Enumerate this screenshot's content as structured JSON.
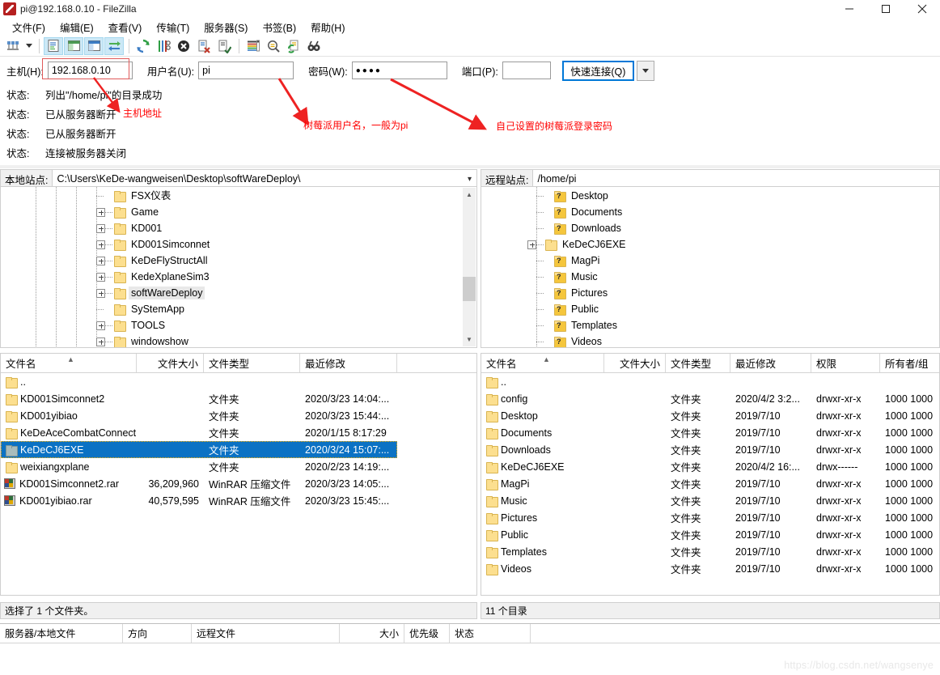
{
  "window": {
    "title": "pi@192.168.0.10 - FileZilla",
    "icon": "filezilla-icon",
    "minimize": "minimize-icon",
    "maximize": "maximize-icon",
    "close": "close-icon"
  },
  "menubar": {
    "items": [
      {
        "label": "文件(F)",
        "name": "menu-file"
      },
      {
        "label": "编辑(E)",
        "name": "menu-edit"
      },
      {
        "label": "查看(V)",
        "name": "menu-view"
      },
      {
        "label": "传输(T)",
        "name": "menu-transfer"
      },
      {
        "label": "服务器(S)",
        "name": "menu-server"
      },
      {
        "label": "书签(B)",
        "name": "menu-bookmarks"
      },
      {
        "label": "帮助(H)",
        "name": "menu-help"
      }
    ]
  },
  "toolbar": {
    "buttons": [
      {
        "name": "site-manager-icon",
        "pressed": false
      },
      {
        "name": "dropdown-caret-icon",
        "pressed": false
      },
      {
        "name": "toggle-message-log-icon",
        "pressed": true
      },
      {
        "name": "toggle-local-tree-icon",
        "pressed": true
      },
      {
        "name": "toggle-remote-tree-icon",
        "pressed": true
      },
      {
        "name": "toggle-transfer-queue-icon",
        "pressed": true
      },
      {
        "name": "refresh-icon",
        "pressed": false
      },
      {
        "name": "process-queue-icon",
        "pressed": false
      },
      {
        "name": "cancel-operation-icon",
        "pressed": false
      },
      {
        "name": "disconnect-icon",
        "pressed": false
      },
      {
        "name": "reconnect-icon",
        "pressed": false
      },
      {
        "name": "filter-icon",
        "pressed": false
      },
      {
        "name": "compare-directories-icon",
        "pressed": false
      },
      {
        "name": "directory-sync-icon",
        "pressed": false
      },
      {
        "name": "find-files-icon",
        "pressed": false
      }
    ]
  },
  "connection": {
    "host_label": "主机(H):",
    "host_value": "192.168.0.10",
    "user_label": "用户名(U):",
    "user_value": "pi",
    "pass_label": "密码(W):",
    "pass_value": "●●●●",
    "port_label": "端口(P):",
    "port_value": "",
    "quick_connect": "快速连接(Q)",
    "quick_connect_dropdown": "chevron-down-icon"
  },
  "log": {
    "rows": [
      {
        "key": "状态:",
        "msg": "列出\"/home/pi\"的目录成功"
      },
      {
        "key": "状态:",
        "msg": "已从服务器断开"
      },
      {
        "key": "状态:",
        "msg": "已从服务器断开"
      },
      {
        "key": "状态:",
        "msg": "连接被服务器关闭"
      }
    ]
  },
  "annotations": [
    {
      "text": "主机地址",
      "name": "annotation-host-address"
    },
    {
      "text": "树莓派用户名，一般为pi",
      "name": "annotation-username"
    },
    {
      "text": "自己设置的树莓派登录密码",
      "name": "annotation-password"
    }
  ],
  "local": {
    "site_label": "本地站点:",
    "site_path": "C:\\Users\\KeDe-wangweisen\\Desktop\\softWareDeploy\\",
    "tree": [
      {
        "label": "FSX仪表",
        "expandable": false,
        "selected": false
      },
      {
        "label": "Game",
        "expandable": true,
        "selected": false
      },
      {
        "label": "KD001",
        "expandable": true,
        "selected": false
      },
      {
        "label": "KD001Simconnet",
        "expandable": true,
        "selected": false
      },
      {
        "label": "KeDeFlyStructAll",
        "expandable": true,
        "selected": false
      },
      {
        "label": "KedeXplaneSim3",
        "expandable": true,
        "selected": false
      },
      {
        "label": "softWareDeploy",
        "expandable": true,
        "selected": true
      },
      {
        "label": "SyStemApp",
        "expandable": false,
        "selected": false
      },
      {
        "label": "TOOLS",
        "expandable": true,
        "selected": false
      },
      {
        "label": "windowshow",
        "expandable": true,
        "selected": false
      }
    ],
    "columns": [
      "文件名",
      "文件大小",
      "文件类型",
      "最近修改"
    ],
    "files": [
      {
        "name": "..",
        "size": "",
        "type": "",
        "modified": "",
        "icon": "folder",
        "selected": false
      },
      {
        "name": "KD001Simconnet2",
        "size": "",
        "type": "文件夹",
        "modified": "2020/3/23 14:04:...",
        "icon": "folder",
        "selected": false
      },
      {
        "name": "KD001yibiao",
        "size": "",
        "type": "文件夹",
        "modified": "2020/3/23 15:44:...",
        "icon": "folder",
        "selected": false
      },
      {
        "name": "KeDeAceCombatConnect",
        "size": "",
        "type": "文件夹",
        "modified": "2020/1/15 8:17:29",
        "icon": "folder",
        "selected": false
      },
      {
        "name": "KeDeCJ6EXE",
        "size": "",
        "type": "文件夹",
        "modified": "2020/3/24 15:07:...",
        "icon": "folder-grey",
        "selected": true
      },
      {
        "name": "weixiangxplane",
        "size": "",
        "type": "文件夹",
        "modified": "2020/2/23 14:19:...",
        "icon": "folder",
        "selected": false
      },
      {
        "name": "KD001Simconnet2.rar",
        "size": "36,209,960",
        "type": "WinRAR 压缩文件",
        "modified": "2020/3/23 14:05:...",
        "icon": "rar",
        "selected": false
      },
      {
        "name": "KD001yibiao.rar",
        "size": "40,579,595",
        "type": "WinRAR 压缩文件",
        "modified": "2020/3/23 15:45:...",
        "icon": "rar",
        "selected": false
      }
    ],
    "status": "选择了 1 个文件夹。"
  },
  "remote": {
    "site_label": "远程站点:",
    "site_path": "/home/pi",
    "tree": [
      {
        "label": "Desktop",
        "expandable": false,
        "icon": "question-folder"
      },
      {
        "label": "Documents",
        "expandable": false,
        "icon": "question-folder"
      },
      {
        "label": "Downloads",
        "expandable": false,
        "icon": "question-folder"
      },
      {
        "label": "KeDeCJ6EXE",
        "expandable": true,
        "icon": "folder"
      },
      {
        "label": "MagPi",
        "expandable": false,
        "icon": "question-folder"
      },
      {
        "label": "Music",
        "expandable": false,
        "icon": "question-folder"
      },
      {
        "label": "Pictures",
        "expandable": false,
        "icon": "question-folder"
      },
      {
        "label": "Public",
        "expandable": false,
        "icon": "question-folder"
      },
      {
        "label": "Templates",
        "expandable": false,
        "icon": "question-folder"
      },
      {
        "label": "Videos",
        "expandable": false,
        "icon": "question-folder"
      }
    ],
    "columns": [
      "文件名",
      "文件大小",
      "文件类型",
      "最近修改",
      "权限",
      "所有者/组"
    ],
    "files": [
      {
        "name": "..",
        "size": "",
        "type": "",
        "modified": "",
        "perm": "",
        "owner": ""
      },
      {
        "name": "config",
        "size": "",
        "type": "文件夹",
        "modified": "2020/4/2 3:2...",
        "perm": "drwxr-xr-x",
        "owner": "1000 1000"
      },
      {
        "name": "Desktop",
        "size": "",
        "type": "文件夹",
        "modified": "2019/7/10",
        "perm": "drwxr-xr-x",
        "owner": "1000 1000"
      },
      {
        "name": "Documents",
        "size": "",
        "type": "文件夹",
        "modified": "2019/7/10",
        "perm": "drwxr-xr-x",
        "owner": "1000 1000"
      },
      {
        "name": "Downloads",
        "size": "",
        "type": "文件夹",
        "modified": "2019/7/10",
        "perm": "drwxr-xr-x",
        "owner": "1000 1000"
      },
      {
        "name": "KeDeCJ6EXE",
        "size": "",
        "type": "文件夹",
        "modified": "2020/4/2 16:...",
        "perm": "drwx------",
        "owner": "1000 1000"
      },
      {
        "name": "MagPi",
        "size": "",
        "type": "文件夹",
        "modified": "2019/7/10",
        "perm": "drwxr-xr-x",
        "owner": "1000 1000"
      },
      {
        "name": "Music",
        "size": "",
        "type": "文件夹",
        "modified": "2019/7/10",
        "perm": "drwxr-xr-x",
        "owner": "1000 1000"
      },
      {
        "name": "Pictures",
        "size": "",
        "type": "文件夹",
        "modified": "2019/7/10",
        "perm": "drwxr-xr-x",
        "owner": "1000 1000"
      },
      {
        "name": "Public",
        "size": "",
        "type": "文件夹",
        "modified": "2019/7/10",
        "perm": "drwxr-xr-x",
        "owner": "1000 1000"
      },
      {
        "name": "Templates",
        "size": "",
        "type": "文件夹",
        "modified": "2019/7/10",
        "perm": "drwxr-xr-x",
        "owner": "1000 1000"
      },
      {
        "name": "Videos",
        "size": "",
        "type": "文件夹",
        "modified": "2019/7/10",
        "perm": "drwxr-xr-x",
        "owner": "1000 1000"
      }
    ],
    "status": "11 个目录"
  },
  "queue": {
    "columns": [
      "服务器/本地文件",
      "方向",
      "远程文件",
      "大小",
      "优先级",
      "状态"
    ]
  },
  "watermark": "https://blog.csdn.net/wangsenye",
  "colors": {
    "selection": "#0b72c4",
    "accent": "#0078d7",
    "annotation": "#ff0000",
    "folder": "#fcdf8f",
    "panel_bg": "#f0f0f0"
  }
}
